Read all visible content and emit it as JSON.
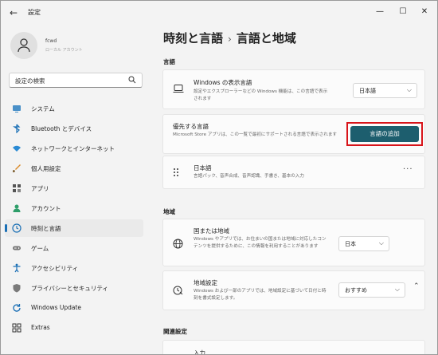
{
  "window": {
    "title": "設定"
  },
  "user": {
    "name": "fcwd",
    "account": "ローカル アカウント"
  },
  "search": {
    "placeholder": "設定の検索"
  },
  "sidebar": {
    "items": [
      {
        "label": "システム",
        "icon": "monitor-icon"
      },
      {
        "label": "Bluetooth とデバイス",
        "icon": "bluetooth-icon"
      },
      {
        "label": "ネットワークとインターネット",
        "icon": "wifi-icon"
      },
      {
        "label": "個人用設定",
        "icon": "brush-icon"
      },
      {
        "label": "アプリ",
        "icon": "apps-icon"
      },
      {
        "label": "アカウント",
        "icon": "person-icon"
      },
      {
        "label": "時刻と言語",
        "icon": "clock-globe-icon",
        "active": true
      },
      {
        "label": "ゲーム",
        "icon": "gamepad-icon"
      },
      {
        "label": "アクセシビリティ",
        "icon": "accessibility-icon"
      },
      {
        "label": "プライバシーとセキュリティ",
        "icon": "shield-icon"
      },
      {
        "label": "Windows Update",
        "icon": "update-icon"
      },
      {
        "label": "Extras",
        "icon": "extras-icon"
      }
    ]
  },
  "breadcrumb": {
    "parent": "時刻と言語",
    "separator": "›",
    "current": "言語と地域"
  },
  "language": {
    "section_title": "言語",
    "display": {
      "title": "Windows の表示言語",
      "desc": "設定やエクスプローラーなどの Windows 機能は、この言語で表示されます",
      "value": "日本語"
    },
    "preferred": {
      "title": "優先する言語",
      "desc": "Microsoft Store アプリは、この一覧で最初にサポートされる言語で表示されます",
      "button": "言語の追加"
    },
    "installed": {
      "title": "日本語",
      "desc": "言語パック、音声合成、音声認識、手書き、基本の入力",
      "more": "···"
    }
  },
  "region": {
    "section_title": "地域",
    "country": {
      "title": "国または地域",
      "desc": "Windows やアプリでは、お住まいの国または地域に対応したコンテンツを提供するために、この情報を利用することがあります",
      "value": "日本"
    },
    "format": {
      "title": "地域設定",
      "desc": "Windows および一部のアプリでは、地域設定に基づいて日付と時刻を書式設定します。",
      "value": "おすすめ"
    }
  },
  "related": {
    "section_title": "関連設定",
    "first_item": "入力"
  },
  "colors": {
    "accent": "#1d5e6e",
    "highlight": "#d8141a",
    "nav_bar": "#1a6fb5"
  }
}
